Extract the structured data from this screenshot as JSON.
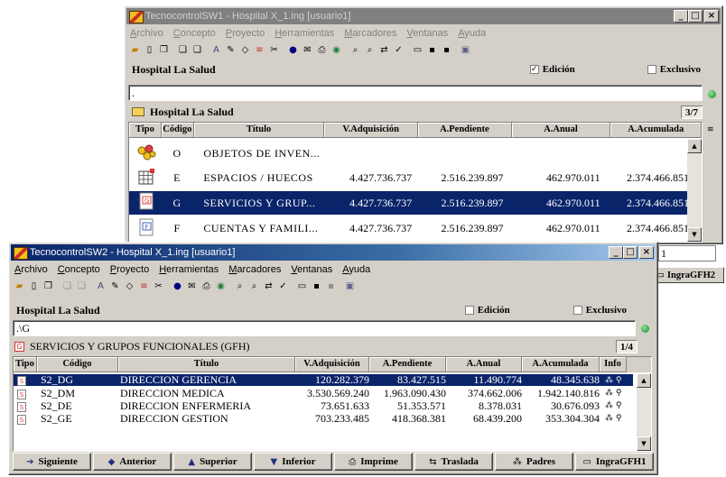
{
  "window1": {
    "title": "TecnocontrolSW1 - Hospital X_1.ing  [usuario1]",
    "menu": [
      "Archivo",
      "Concepto",
      "Proyecto",
      "Herramientas",
      "Marcadores",
      "Ventanas",
      "Ayuda"
    ],
    "project_label": "Hospital La Salud",
    "edicion_label": "Edición",
    "edicion_checked": true,
    "exclusivo_label": "Exclusivo",
    "exclusivo_checked": false,
    "path": ".",
    "node_title": "Hospital La Salud",
    "counter": "3/7",
    "columns": [
      "Tipo",
      "Código",
      "Título",
      "V.Adquisición",
      "A.Pendiente",
      "A.Anual",
      "A.Acumulada"
    ],
    "rows": [
      {
        "icon": "objects-folder-icon",
        "codigo": "O",
        "titulo": "OBJETOS DE INVEN...",
        "v_adq": "",
        "a_pend": "",
        "a_anual": "",
        "a_acum": "",
        "selected": false
      },
      {
        "icon": "spaces-grid-icon",
        "codigo": "E",
        "titulo": "ESPACIOS / HUECOS",
        "v_adq": "4.427.736.737",
        "a_pend": "2.516.239.897",
        "a_anual": "462.970.011",
        "a_acum": "2.374.466.851",
        "selected": false
      },
      {
        "icon": "services-document-icon",
        "codigo": "G",
        "titulo": "SERVICIOS Y GRUP...",
        "v_adq": "4.427.736.737",
        "a_pend": "2.516.239.897",
        "a_anual": "462.970.011",
        "a_acum": "2.374.466.851",
        "selected": true
      },
      {
        "icon": "accounts-document-icon",
        "codigo": "F",
        "titulo": "CUENTAS Y FAMILI...",
        "v_adq": "4.427.736.737",
        "a_pend": "2.516.239.897",
        "a_anual": "462.970.011",
        "a_acum": "2.374.466.851",
        "selected": false
      }
    ],
    "peek_value": "1",
    "side_button": "IngraGFH2"
  },
  "window2": {
    "title": "TecnocontrolSW2 - Hospital X_1.ing  [usuario1]",
    "menu": [
      "Archivo",
      "Concepto",
      "Proyecto",
      "Herramientas",
      "Marcadores",
      "Ventanas",
      "Ayuda"
    ],
    "project_label": "Hospital La Salud",
    "edicion_label": "Edición",
    "edicion_checked": false,
    "exclusivo_label": "Exclusivo",
    "exclusivo_checked": false,
    "path": ".\\G",
    "node_title": "SERVICIOS Y GRUPOS FUNCIONALES (GFH)",
    "counter": "1/4",
    "columns": [
      "Tipo",
      "Código",
      "Título",
      "V.Adquisición",
      "A.Pendiente",
      "A.Anual",
      "A.Acumulada",
      "Info"
    ],
    "rows": [
      {
        "codigo": "S2_DG",
        "titulo": "DIRECCION GERENCIA",
        "v_adq": "120.282.379",
        "a_pend": "83.427.515",
        "a_anual": "11.490.774",
        "a_acum": "48.345.638",
        "selected": true
      },
      {
        "codigo": "S2_DM",
        "titulo": "DIRECCION MEDICA",
        "v_adq": "3.530.569.240",
        "a_pend": "1.963.090.430",
        "a_anual": "374.662.006",
        "a_acum": "1.942.140.816",
        "selected": false
      },
      {
        "codigo": "S2_DE",
        "titulo": "DIRECCION ENFERMERIA",
        "v_adq": "73.651.633",
        "a_pend": "51.353.571",
        "a_anual": "8.378.031",
        "a_acum": "30.676.093",
        "selected": false
      },
      {
        "codigo": "S2_GE",
        "titulo": "DIRECCION GESTION",
        "v_adq": "703.233.485",
        "a_pend": "418.368.381",
        "a_anual": "68.439.200",
        "a_acum": "353.304.304",
        "selected": false
      }
    ],
    "buttons": [
      {
        "label": "Siguiente",
        "icon": "arrow-right-icon"
      },
      {
        "label": "Anterior",
        "icon": "arrow-left-icon"
      },
      {
        "label": "Superior",
        "icon": "arrow-up-icon"
      },
      {
        "label": "Inferior",
        "icon": "arrow-down-icon"
      },
      {
        "label": "Imprime",
        "icon": "printer-icon"
      },
      {
        "label": "Traslada",
        "icon": "transfer-icon"
      },
      {
        "label": "Padres",
        "icon": "parents-tree-icon"
      },
      {
        "label": "IngraGFH1",
        "icon": "window-icon"
      }
    ]
  },
  "colors": {
    "title_active": "#0a246a",
    "title_inactive": "#808080",
    "selection": "#0a246a",
    "chrome": "#d4d0c8"
  }
}
